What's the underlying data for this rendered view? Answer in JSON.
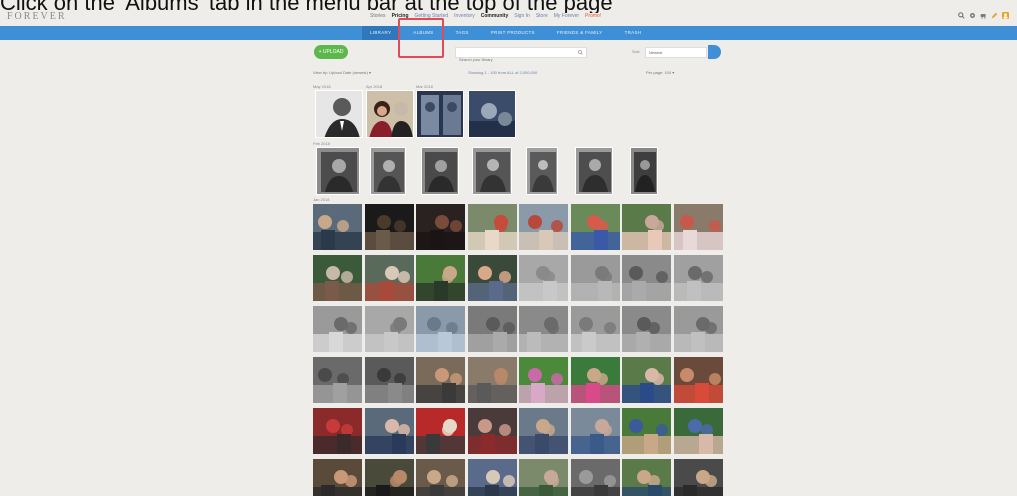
{
  "instruction": "Click on the 'Albums' tab in the menu bar at the top of the page",
  "brand": "FOREVER",
  "top_links": [
    "Stories",
    "Pricing",
    "Getting Started",
    "Inventory",
    "Community",
    "Sign In",
    "Store",
    "My Forever",
    "Promo!"
  ],
  "top_icons": [
    "search-icon",
    "gear-icon",
    "cart-icon",
    "pencil-icon",
    "user-icon"
  ],
  "nav": {
    "items": [
      "LIBRARY",
      "ALBUMS",
      "TAGS",
      "PRINT PRODUCTS",
      "FRIENDS & FAMILY",
      "TRASH"
    ],
    "active_index": 1
  },
  "toolbar": {
    "upload_label": "+ UPLOAD",
    "search_placeholder": "Search your library",
    "sort_label": "Sort:",
    "sort_value": "Newest"
  },
  "filters": {
    "left": "View by: Upload Date (newest)  ▾",
    "middle": "Showing 1 - 100 from ALL of 2,000,000",
    "right": "Per page: 100  ▾"
  },
  "groups": [
    "May 2018",
    "Apr 2018",
    "Mar 2018",
    "Feb 2018",
    "Jan 2018"
  ],
  "colors": {
    "nav_bg": "#3f8fd6",
    "nav_active": "#2e78bb",
    "upload_green": "#5cb84a",
    "highlight": "#e04a5a",
    "background": "#efedea"
  }
}
